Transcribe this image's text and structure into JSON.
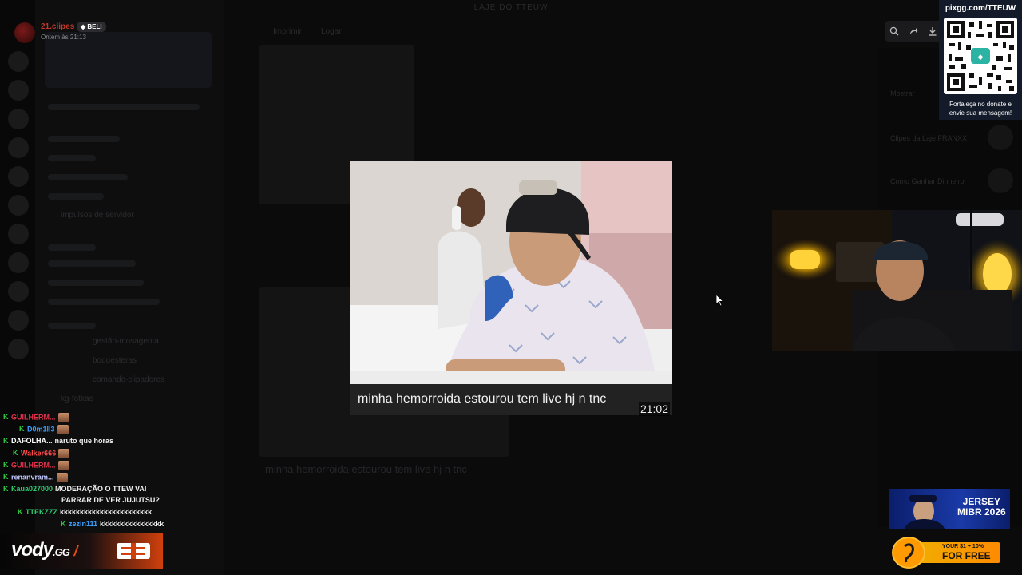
{
  "window": {
    "title": "LAJE DO TTEUW"
  },
  "background": {
    "tabs": [
      "Imprimir",
      "Logar"
    ],
    "channels": [
      "impulsos de servidor",
      "gestão-mosagenta",
      "boquesteras",
      "comando-clipadores",
      "kg-fotkas"
    ],
    "caption_shadow": "minha hemorroida estourou tem live hj n tnc",
    "right_items": [
      "Mostrar",
      "Clipes da Laje FRANXX",
      "Como Ganhar Dinheiro"
    ]
  },
  "notification": {
    "name": "21.clipes",
    "badge": "BELI",
    "time": "Ontem às 21:13"
  },
  "player": {
    "controls": [
      "zoom-icon",
      "share-icon",
      "download-icon"
    ]
  },
  "qr": {
    "url": "pixgg.com/TTEUW",
    "text": "Fortaleça no donate e envie sua mensagem!"
  },
  "popup": {
    "caption": "minha hemorroida estourou tem live hj n tnc",
    "duration": "21:02"
  },
  "chat": [
    {
      "user": "GUILHERM...",
      "color": "#e0324a",
      "message": "",
      "emote": true,
      "indent": 0
    },
    {
      "user": "D0m1lI3",
      "color": "#3aa0ff",
      "message": "",
      "emote": true,
      "indent": 1
    },
    {
      "user": "DAFOLHA...",
      "color": "#ffffff",
      "message": "naruto que horas",
      "emote": false,
      "indent": 0
    },
    {
      "user": "Walker666",
      "color": "#ff4a4a",
      "message": "",
      "emote": true,
      "indent": 1
    },
    {
      "user": "GUILHERM...",
      "color": "#e0324a",
      "message": "",
      "emote": true,
      "indent": 0
    },
    {
      "user": "renanvram...",
      "color": "#c0c8ff",
      "message": "",
      "emote": true,
      "indent": 0
    },
    {
      "user": "Kaua027000",
      "color": "#2ecc71",
      "message": "MODERAÇÃO O TTEW VAI",
      "message2": "PARRAR DE VER JUJUTSU?",
      "emote": false,
      "indent": 0
    },
    {
      "user": "TTEKZZZ",
      "color": "#2ecc71",
      "message": "kkkkkkkkkkkkkkkkkkkkkkk",
      "emote": false,
      "indent": 1
    },
    {
      "user": "zezin111",
      "color": "#3aa0ff",
      "message": "kkkkkkkkkkkkkkkk",
      "emote": false,
      "indent": 2
    }
  ],
  "vody": {
    "brand": "vody",
    "tld": ".GG",
    "slash": "/"
  },
  "ads": {
    "jersey_title": "JERSEY",
    "jersey_sub": "MIBR 2026",
    "free_small": "YOUR $1 + 10%",
    "free_big": "FOR FREE"
  }
}
